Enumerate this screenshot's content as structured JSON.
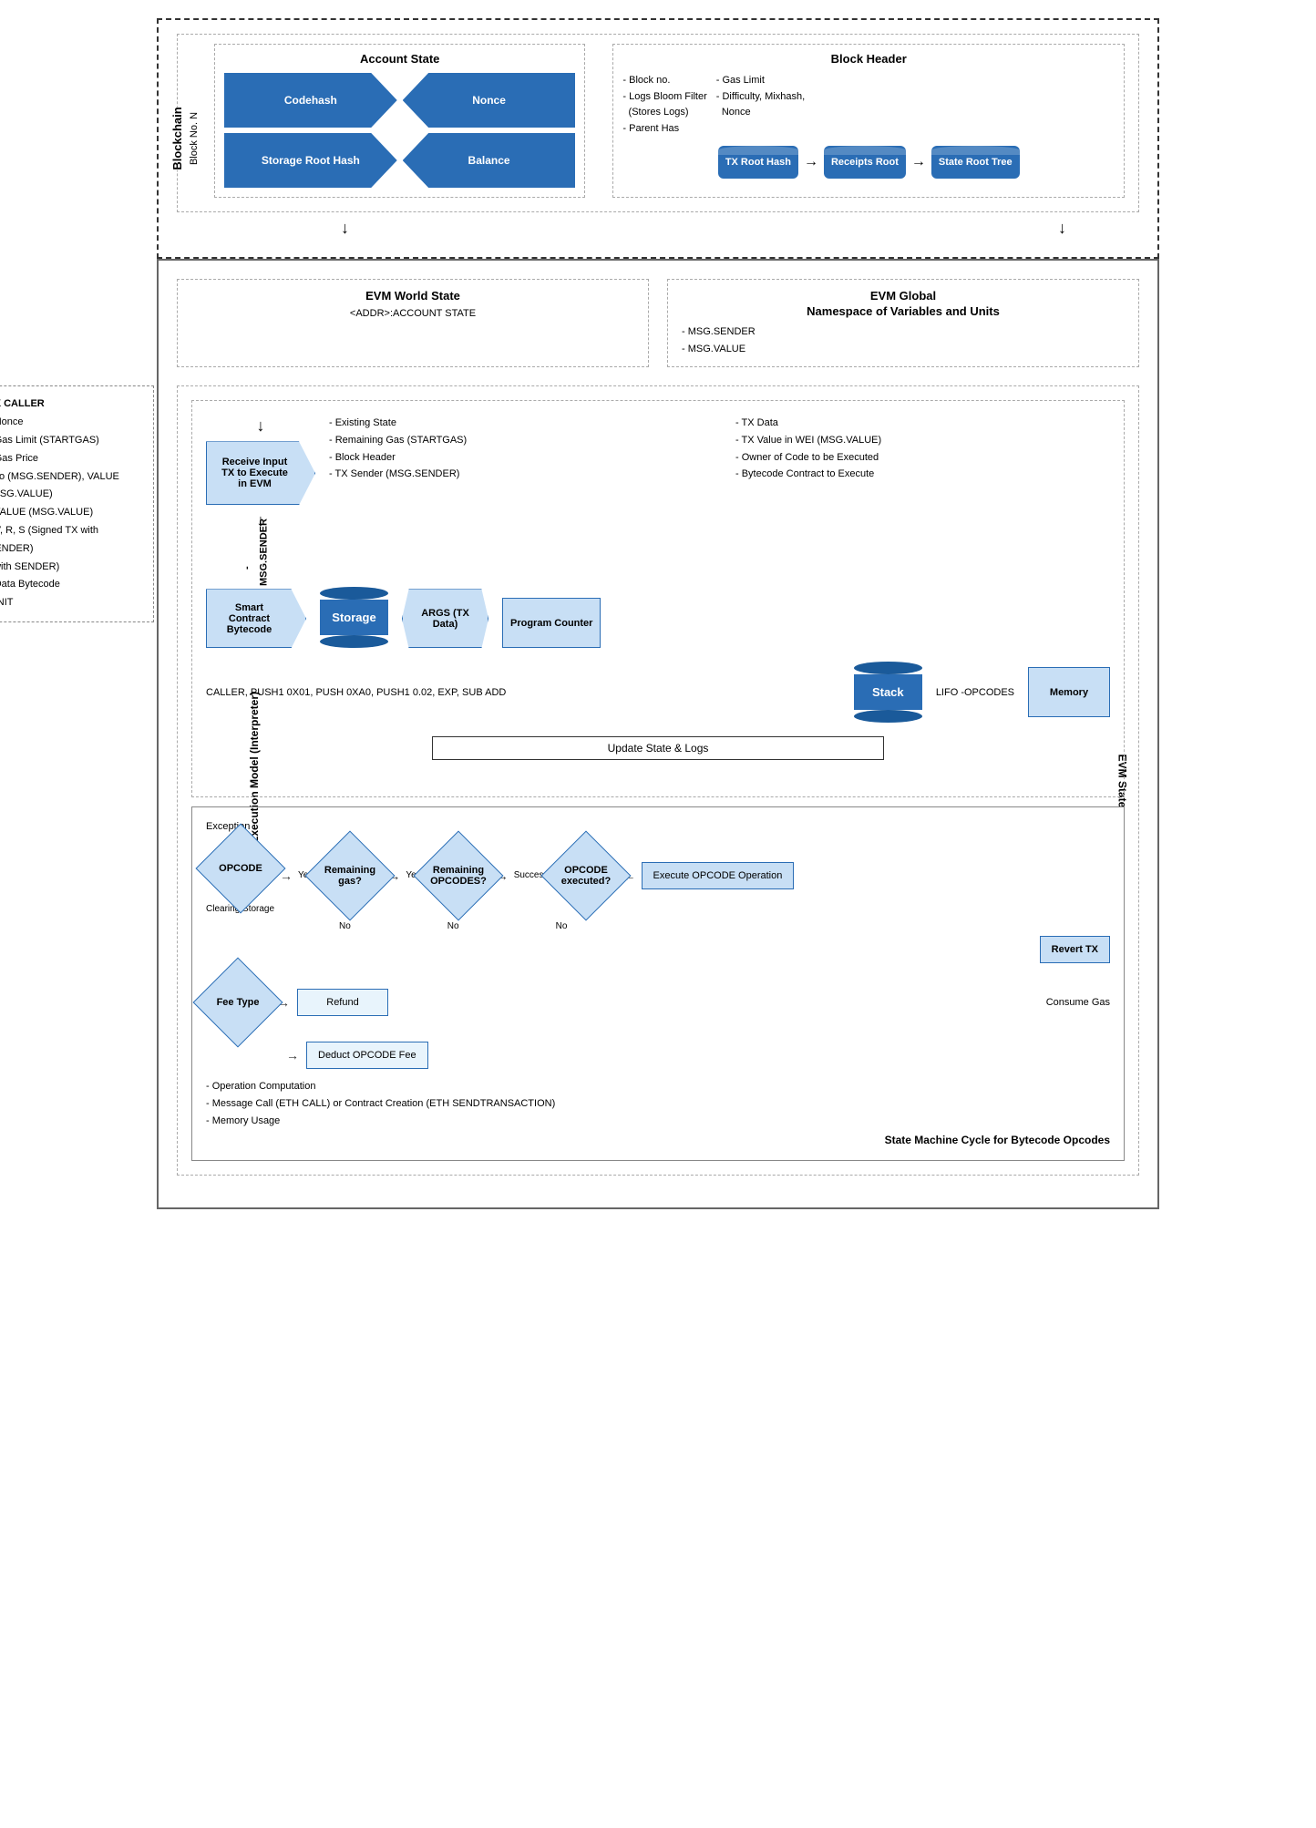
{
  "blockchain": {
    "outer_label": "Blockchain",
    "inner_label": "Block No. N",
    "account_state": {
      "title": "Account State",
      "items": [
        "Codehash",
        "Nonce",
        "Storage Root Hash",
        "Balance"
      ]
    },
    "block_header": {
      "title": "Block Header",
      "left_items": [
        "- Block no.",
        "- Logs Bloom Filter (Stores Logs)",
        "- Parent Has"
      ],
      "right_items": [
        "- Gas Limit",
        "- Difficulty, Mixhash, Nonce"
      ],
      "cylinders": [
        "TX Root Hash",
        "Receipts Root",
        "State Root Tree"
      ]
    }
  },
  "evm": {
    "world_state": {
      "title": "EVM World State",
      "subtitle": "<ADDR>:ACCOUNT STATE"
    },
    "global_ns": {
      "title": "EVM Global",
      "subtitle": "Namespace of Variables and Units",
      "items": [
        "- MSG.SENDER",
        "- MSG.VALUE"
      ]
    },
    "state_section": {
      "state_label": "EVM State",
      "exec_label": "EVM Execution Model (Interpreter)",
      "receive_tx": "Receive Input TX to Execute in EVM",
      "tx_info_left": [
        "- Existing State",
        "- Remaining Gas (STARTGAS)",
        "- Block Header",
        "- TX Sender (MSG.SENDER)"
      ],
      "tx_info_right": [
        "- TX Data",
        "- TX Value in WEI (MSG.VALUE)",
        "- Owner of Code to be Executed",
        "- Bytecode Contract to Execute"
      ],
      "msg_sender": "- MSG.SENDER",
      "components": {
        "smart_contract": "Smart Contract Bytecode",
        "storage": "Storage",
        "args": "ARGS (TX Data)",
        "program_counter": "Program Counter"
      },
      "stack_text": "CALLER, PUSH1 0X01, PUSH 0XA0, PUSH1 0.02, EXP, SUB ADD",
      "stack": {
        "label": "Stack",
        "sublabel": "LIFO -OPCODES"
      },
      "memory": "Memory",
      "update_state": "Update State & Logs"
    },
    "opcodes_flow": {
      "exception_label": "Exception",
      "opcode_label": "OPCODE",
      "clearing_storage": "Clearing Storage",
      "remaining_gas": "Remaining gas?",
      "remaining_opcodes": "Remaining OPCODES?",
      "opcode_executed": "OPCODE executed?",
      "execute_opcode": "Execute OPCODE Operation",
      "yes_label": "Yes",
      "no_label": "No",
      "success_label": "Success",
      "revert_tx": "Revert TX",
      "fee_type": "Fee Type",
      "refund": "Refund",
      "deduct_fee": "Deduct OPCODE Fee",
      "consume_gas": "Consume Gas",
      "bottom_items": [
        "- Operation Computation",
        "- Message Call (ETH CALL) or Contract Creation (ETH SENDTRANSACTION)",
        "- Memory Usage"
      ],
      "state_machine_label": "State Machine Cycle for Bytecode Opcodes"
    },
    "tx_caller": {
      "title": "TX CALLER",
      "items": [
        "- Nonce",
        "- Gas Limit (STARTGAS)",
        "- Gas Price",
        "- To (MSG.SENDER), VALUE (MSG.VALUE)",
        "- V, R, S (Signed TX with SENDER)",
        "- Data Bytecode",
        "- INIT"
      ]
    }
  }
}
